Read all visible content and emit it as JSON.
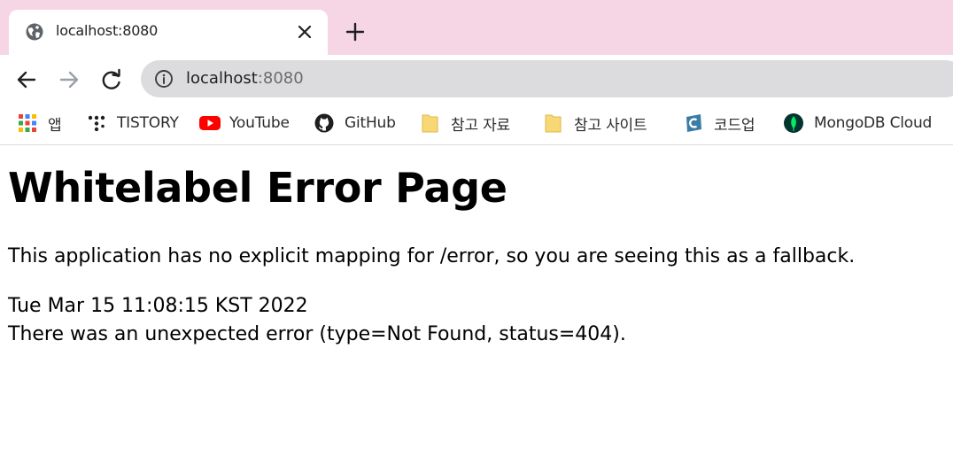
{
  "browser": {
    "tab": {
      "title": "localhost:8080",
      "favicon": "globe-icon"
    },
    "new_tab_icon": "plus-icon",
    "toolbar": {
      "back_icon": "arrow-left-icon",
      "forward_icon": "arrow-right-icon",
      "reload_icon": "reload-icon",
      "info_icon": "info-icon",
      "url": {
        "host": "localhost",
        "port": ":8080"
      }
    },
    "bookmarks": [
      {
        "label": "앱",
        "icon": "apps-grid-icon"
      },
      {
        "label": "TISTORY",
        "icon": "tistory-icon"
      },
      {
        "label": "YouTube",
        "icon": "youtube-icon"
      },
      {
        "label": "GitHub",
        "icon": "github-icon"
      },
      {
        "label": "참고 자료",
        "icon": "folder-icon"
      },
      {
        "label": "참고 사이트",
        "icon": "folder-icon"
      },
      {
        "label": "코드업",
        "icon": "codeup-icon"
      },
      {
        "label": "MongoDB Cloud",
        "icon": "mongodb-leaf-icon"
      }
    ]
  },
  "page": {
    "heading": "Whitelabel Error Page",
    "message": "This application has no explicit mapping for /error, so you are seeing this as a fallback.",
    "timestamp": "Tue Mar 15 11:08:15 KST 2022",
    "error": "There was an unexpected error (type=Not Found, status=404)."
  },
  "colors": {
    "tabstrip": "#f6d5e5",
    "omnibox": "#dcdcdf",
    "youtube_red": "#ff0000",
    "folder_yellow": "#f8d775",
    "mongodb_green": "#00ed64"
  }
}
